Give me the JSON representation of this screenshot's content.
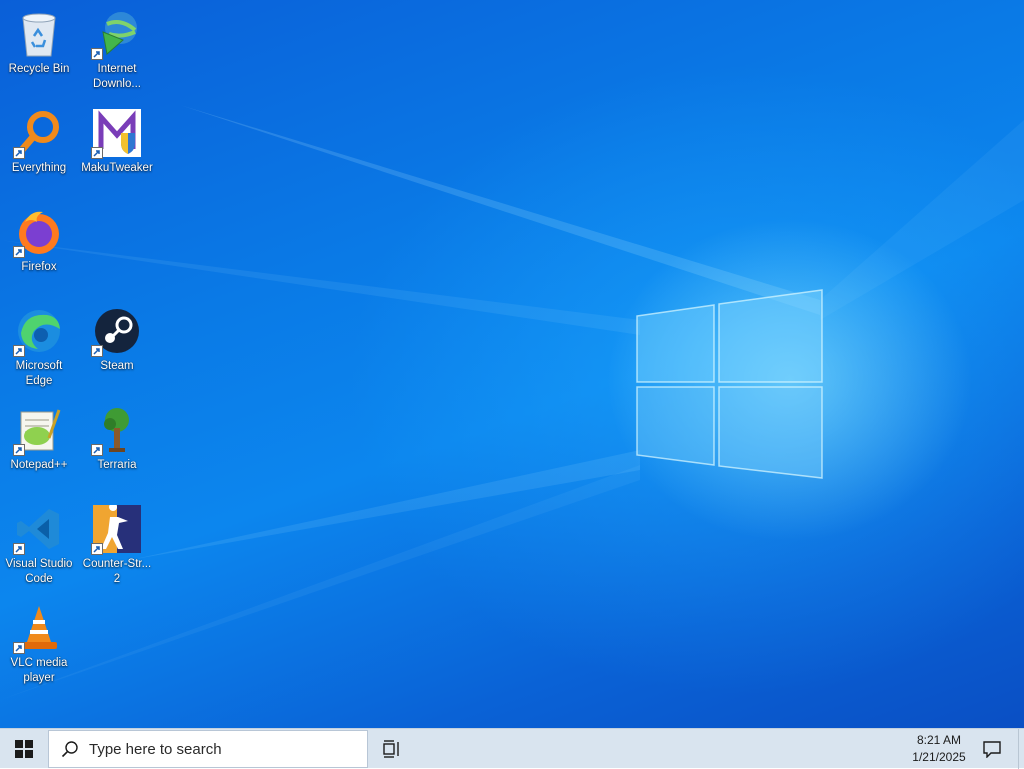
{
  "desktop": {
    "icons": [
      {
        "label": "Recycle Bin",
        "icon": "recycle-bin-icon"
      },
      {
        "label": "Internet\nDownlo...",
        "icon": "internet-download-manager-icon"
      },
      {
        "label": "Everything",
        "icon": "everything-search-icon"
      },
      {
        "label": "MakuTweaker",
        "icon": "makutweaker-icon"
      },
      {
        "label": "Firefox",
        "icon": "firefox-icon"
      },
      {
        "label": "Microsoft\nEdge",
        "icon": "edge-icon"
      },
      {
        "label": "Steam",
        "icon": "steam-icon"
      },
      {
        "label": "Notepad++",
        "icon": "notepad-plus-plus-icon"
      },
      {
        "label": "Terraria",
        "icon": "terraria-icon"
      },
      {
        "label": "Visual Studio\nCode",
        "icon": "vscode-icon"
      },
      {
        "label": "Counter-Str...\n2",
        "icon": "counter-strike-icon"
      },
      {
        "label": "VLC media\nplayer",
        "icon": "vlc-icon"
      }
    ]
  },
  "taskbar": {
    "start_icon": "windows-logo-icon",
    "search_placeholder": "Type here to search",
    "task_view_icon": "task-view-icon",
    "clock_time": "8:21 AM",
    "clock_date": "1/21/2025",
    "notification_icon": "action-center-icon"
  },
  "colors": {
    "wallpaper_accent": "#0a78e6",
    "taskbar_bg": "#d9e4ef"
  }
}
